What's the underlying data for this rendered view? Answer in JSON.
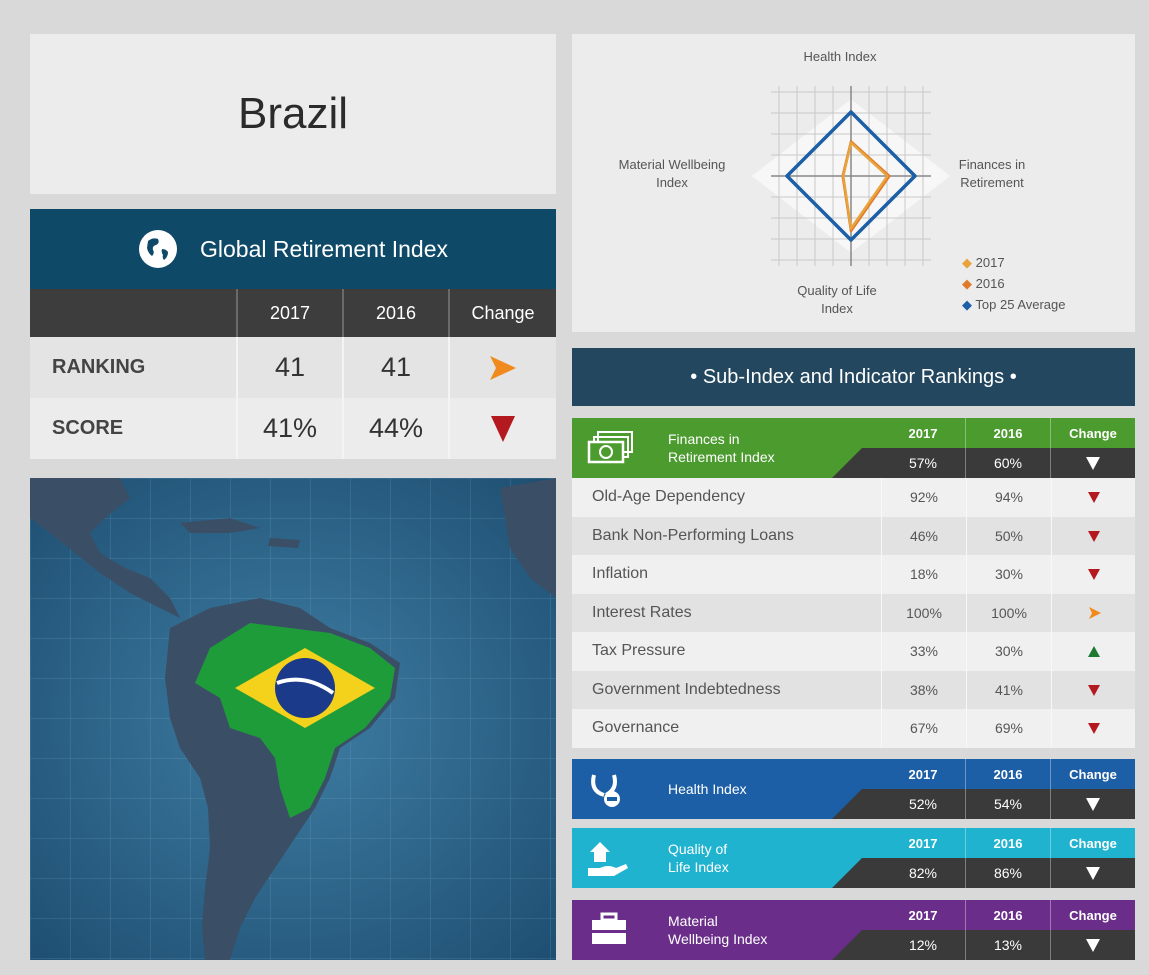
{
  "country": "Brazil",
  "global_index": {
    "title": "Global Retirement Index",
    "columns": [
      "2017",
      "2016",
      "Change"
    ],
    "rows": [
      {
        "label": "RANKING",
        "v2017": "41",
        "v2016": "41",
        "change": "same"
      },
      {
        "label": "SCORE",
        "v2017": "41%",
        "v2016": "44%",
        "change": "down"
      }
    ]
  },
  "radar": {
    "axes": [
      "Health Index",
      "Finances in Retirement",
      "Quality of Life Index",
      "Material Wellbeing Index"
    ],
    "legend": [
      {
        "label": "2017",
        "color": "#e8a33d"
      },
      {
        "label": "2016",
        "color": "#e07a2a"
      },
      {
        "label": "Top 25 Average",
        "color": "#1d5fa6"
      }
    ],
    "series": [
      {
        "name": "2017",
        "values": [
          0.52,
          0.57,
          0.82,
          0.12
        ]
      },
      {
        "name": "2016",
        "values": [
          0.54,
          0.6,
          0.86,
          0.13
        ]
      },
      {
        "name": "Top 25 Average",
        "values": [
          1.0,
          1.0,
          1.0,
          1.0
        ]
      }
    ]
  },
  "sub_index": {
    "title": "• Sub-Index and Indicator Rankings •",
    "col_2017": "2017",
    "col_2016": "2016",
    "col_change": "Change",
    "finances": {
      "title_line1": "Finances in",
      "title_line2": "Retirement Index",
      "v2017": "57%",
      "v2016": "60%",
      "color": "#4c9b2f",
      "indicators": [
        {
          "name": "Old-Age Dependency",
          "v2017": "92%",
          "v2016": "94%",
          "change": "down"
        },
        {
          "name": "Bank Non-Performing Loans",
          "v2017": "46%",
          "v2016": "50%",
          "change": "down"
        },
        {
          "name": "Inflation",
          "v2017": "18%",
          "v2016": "30%",
          "change": "down"
        },
        {
          "name": "Interest Rates",
          "v2017": "100%",
          "v2016": "100%",
          "change": "same"
        },
        {
          "name": "Tax Pressure",
          "v2017": "33%",
          "v2016": "30%",
          "change": "up"
        },
        {
          "name": "Government Indebtedness",
          "v2017": "38%",
          "v2016": "41%",
          "change": "down"
        },
        {
          "name": "Governance",
          "v2017": "67%",
          "v2016": "69%",
          "change": "down"
        }
      ]
    },
    "health": {
      "title_line1": "Health Index",
      "title_line2": "",
      "v2017": "52%",
      "v2016": "54%",
      "color": "#1d5fa6"
    },
    "quality": {
      "title_line1": "Quality of",
      "title_line2": "Life Index",
      "v2017": "82%",
      "v2016": "86%",
      "color": "#1fb3cf"
    },
    "material": {
      "title_line1": "Material",
      "title_line2": "Wellbeing Index",
      "v2017": "12%",
      "v2016": "13%",
      "color": "#6a2e8a"
    }
  }
}
